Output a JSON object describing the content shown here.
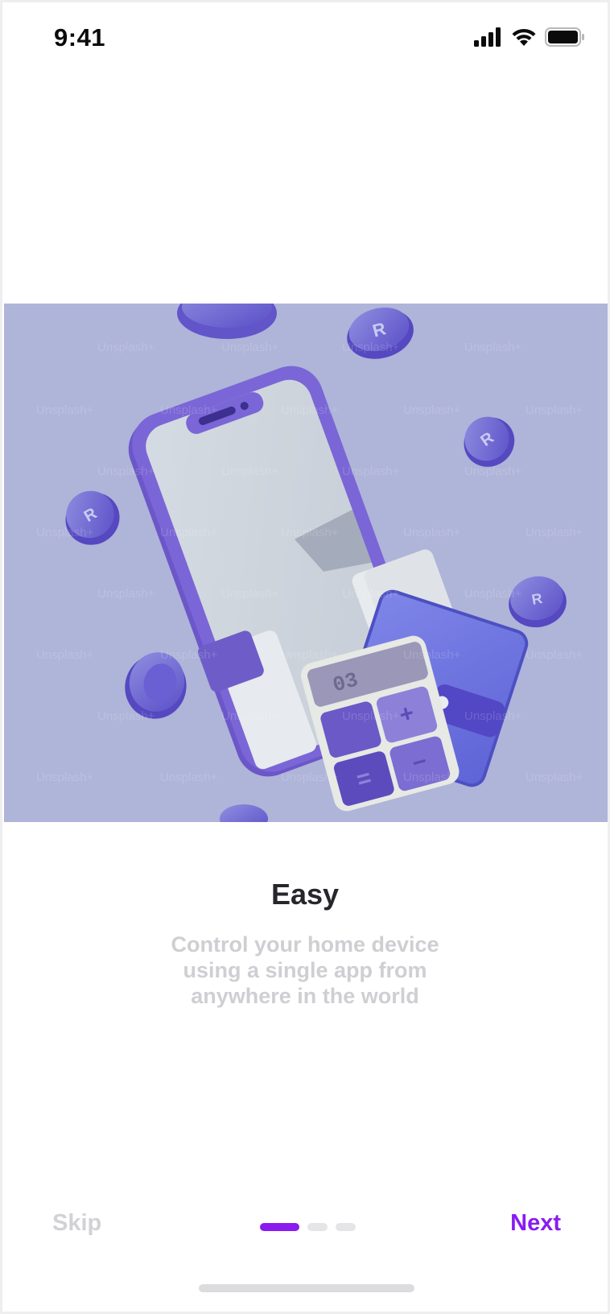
{
  "status_bar": {
    "time": "9:41",
    "icons": [
      "cellular-signal-icon",
      "wifi-icon",
      "battery-icon"
    ]
  },
  "hero": {
    "watermark_text": "Unsplash+",
    "background_color": "#afb4d9"
  },
  "onboarding": {
    "title": "Easy",
    "description": "Control your home device using a single app from anywhere in the world"
  },
  "navigation": {
    "skip_label": "Skip",
    "next_label": "Next",
    "total_pages": 3,
    "current_page": 1,
    "accent_color": "#8a1cf0"
  }
}
